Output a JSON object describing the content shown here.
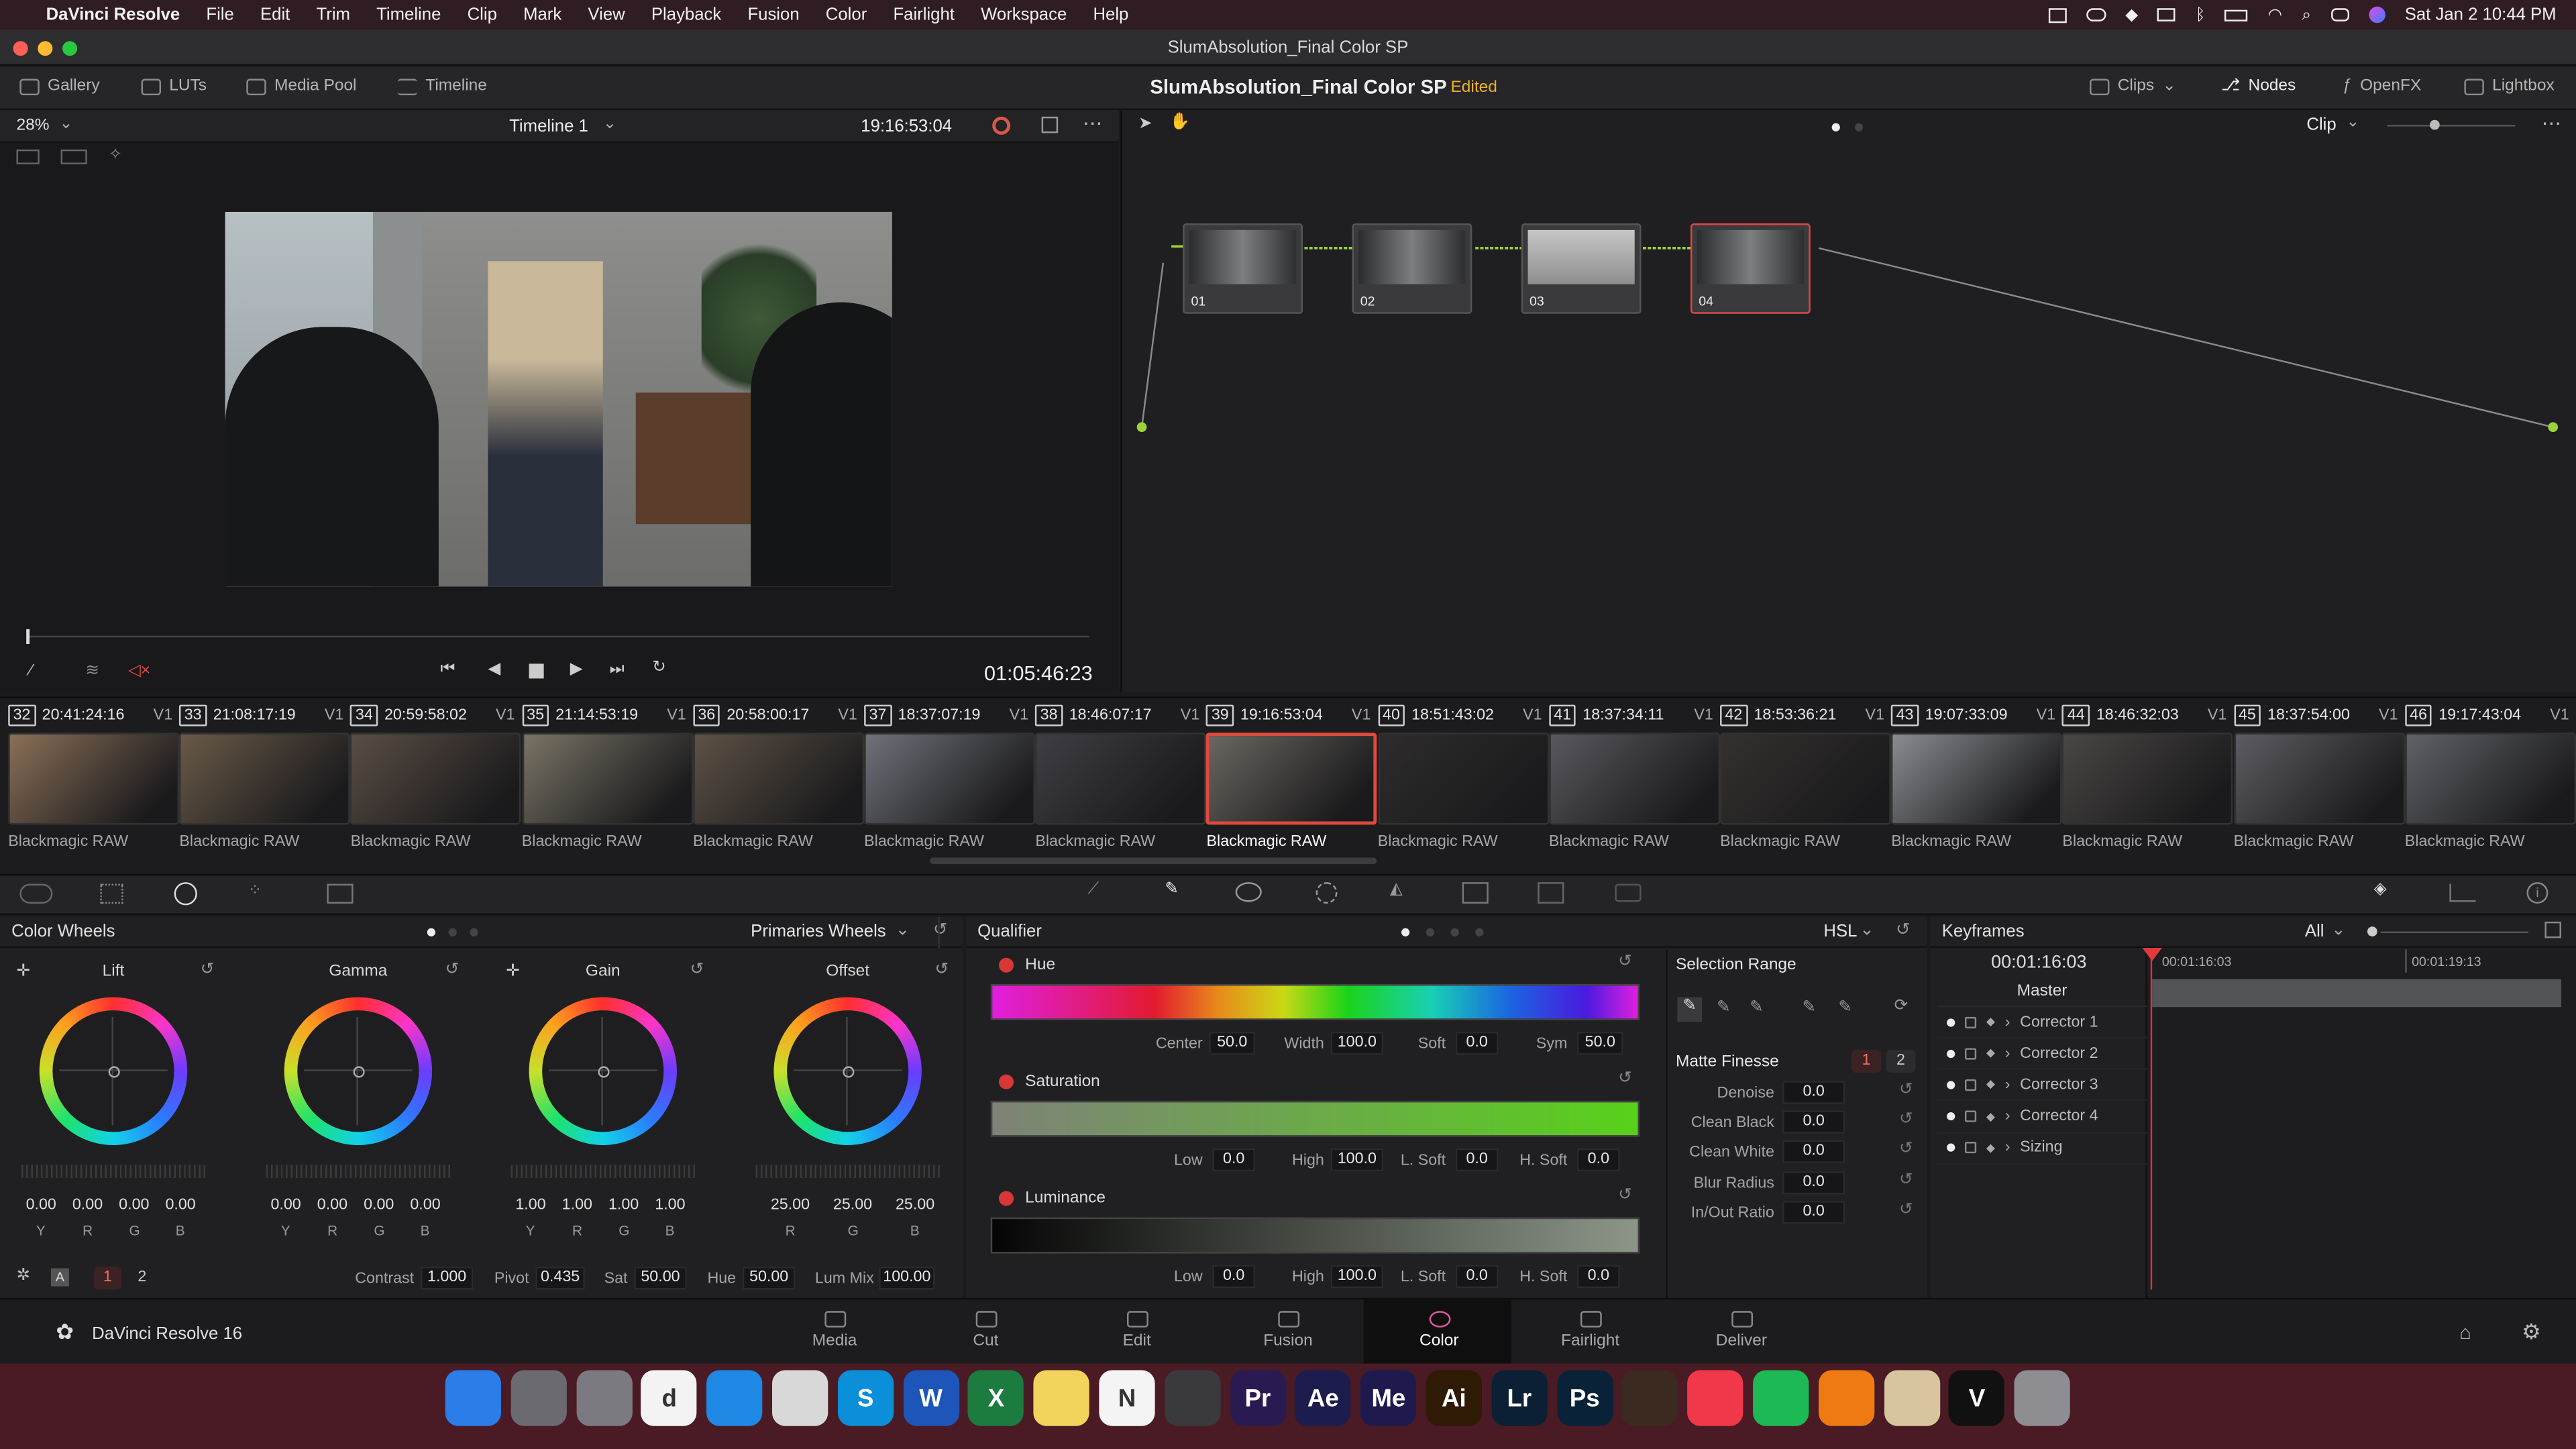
{
  "menubar": {
    "apple": "",
    "app": "DaVinci Resolve",
    "items": [
      "File",
      "Edit",
      "Trim",
      "Timeline",
      "Clip",
      "Mark",
      "View",
      "Playback",
      "Fusion",
      "Color",
      "Fairlight",
      "Workspace",
      "Help"
    ],
    "clock": "Sat Jan 2  10:44 PM"
  },
  "window": {
    "title": "SlumAbsolution_Final Color SP"
  },
  "toolbar": {
    "gallery": "Gallery",
    "luts": "LUTs",
    "media_pool": "Media Pool",
    "timeline": "Timeline",
    "project": "SlumAbsolution_Final Color SP",
    "status": "Edited",
    "clips": "Clips",
    "nodes": "Nodes",
    "openfx": "OpenFX",
    "lightbox": "Lightbox"
  },
  "viewer": {
    "zoom": "28%",
    "timeline_name": "Timeline 1",
    "source_tc": "19:16:53:04",
    "playhead_tc": "01:05:46:23"
  },
  "node_editor": {
    "mode": "Clip",
    "nodes": [
      {
        "label": "01"
      },
      {
        "label": "02"
      },
      {
        "label": "03"
      },
      {
        "label": "04"
      }
    ]
  },
  "clips": [
    {
      "num": "32",
      "tc": "20:41:24:16",
      "track": "V1",
      "name": "Blackmagic RAW",
      "tone": "#8a7058"
    },
    {
      "num": "33",
      "tc": "21:08:17:19",
      "track": "V1",
      "name": "Blackmagic RAW",
      "tone": "#6a5a48"
    },
    {
      "num": "34",
      "tc": "20:59:58:02",
      "track": "V1",
      "name": "Blackmagic RAW",
      "tone": "#5a4e44"
    },
    {
      "num": "35",
      "tc": "21:14:53:19",
      "track": "V1",
      "name": "Blackmagic RAW",
      "tone": "#7a7466"
    },
    {
      "num": "36",
      "tc": "20:58:00:17",
      "track": "V1",
      "name": "Blackmagic RAW",
      "tone": "#5e5246"
    },
    {
      "num": "37",
      "tc": "18:37:07:19",
      "track": "V1",
      "name": "Blackmagic RAW",
      "tone": "#70727a"
    },
    {
      "num": "38",
      "tc": "18:46:07:17",
      "track": "V1",
      "name": "Blackmagic RAW",
      "tone": "#3e3e44"
    },
    {
      "num": "39",
      "tc": "19:16:53:04",
      "track": "V1",
      "name": "Blackmagic RAW",
      "tone": "#6a6660"
    },
    {
      "num": "40",
      "tc": "18:51:43:02",
      "track": "V1",
      "name": "Blackmagic RAW",
      "tone": "#2e2c2c"
    },
    {
      "num": "41",
      "tc": "18:37:34:11",
      "track": "V1",
      "name": "Blackmagic RAW",
      "tone": "#58585e"
    },
    {
      "num": "42",
      "tc": "18:53:36:21",
      "track": "V1",
      "name": "Blackmagic RAW",
      "tone": "#34302e"
    },
    {
      "num": "43",
      "tc": "19:07:33:09",
      "track": "V1",
      "name": "Blackmagic RAW",
      "tone": "#8a8c92"
    },
    {
      "num": "44",
      "tc": "18:46:32:03",
      "track": "V1",
      "name": "Blackmagic RAW",
      "tone": "#4a4644"
    },
    {
      "num": "45",
      "tc": "18:37:54:00",
      "track": "V1",
      "name": "Blackmagic RAW",
      "tone": "#5c5c62"
    },
    {
      "num": "46",
      "tc": "19:17:43:04",
      "track": "V1",
      "name": "Blackmagic RAW",
      "tone": "#606268"
    }
  ],
  "color_wheels": {
    "title": "Color Wheels",
    "mode": "Primaries Wheels",
    "wheels": [
      {
        "name": "Lift",
        "values": [
          "0.00",
          "0.00",
          "0.00",
          "0.00"
        ],
        "channels": [
          "Y",
          "R",
          "G",
          "B"
        ]
      },
      {
        "name": "Gamma",
        "values": [
          "0.00",
          "0.00",
          "0.00",
          "0.00"
        ],
        "channels": [
          "Y",
          "R",
          "G",
          "B"
        ]
      },
      {
        "name": "Gain",
        "values": [
          "1.00",
          "1.00",
          "1.00",
          "1.00"
        ],
        "channels": [
          "Y",
          "R",
          "G",
          "B"
        ]
      },
      {
        "name": "Offset",
        "values": [
          "25.00",
          "25.00",
          "25.00"
        ],
        "channels": [
          "R",
          "G",
          "B"
        ]
      }
    ],
    "page1": "1",
    "page2": "2",
    "contrast_label": "Contrast",
    "contrast": "1.000",
    "pivot_label": "Pivot",
    "pivot": "0.435",
    "sat_label": "Sat",
    "sat": "50.00",
    "hue_label": "Hue",
    "hue": "50.00",
    "lummix_label": "Lum Mix",
    "lummix": "100.00"
  },
  "qualifier": {
    "title": "Qualifier",
    "mode": "HSL",
    "hue": {
      "label": "Hue",
      "center_label": "Center",
      "center": "50.0",
      "width_label": "Width",
      "width": "100.0",
      "soft_label": "Soft",
      "soft": "0.0",
      "sym_label": "Sym",
      "sym": "50.0"
    },
    "saturation": {
      "label": "Saturation",
      "low_label": "Low",
      "low": "0.0",
      "high_label": "High",
      "high": "100.0",
      "lsoft_label": "L. Soft",
      "lsoft": "0.0",
      "hsoft_label": "H. Soft",
      "hsoft": "0.0"
    },
    "luminance": {
      "label": "Luminance",
      "low_label": "Low",
      "low": "0.0",
      "high_label": "High",
      "high": "100.0",
      "lsoft_label": "L. Soft",
      "lsoft": "0.0",
      "hsoft_label": "H. Soft",
      "hsoft": "0.0"
    },
    "selection_range": "Selection Range",
    "matte_finesse": "Matte Finesse",
    "mf_page1": "1",
    "mf_page2": "2",
    "finesse": [
      {
        "label": "Denoise",
        "value": "0.0"
      },
      {
        "label": "Clean Black",
        "value": "0.0"
      },
      {
        "label": "Clean White",
        "value": "0.0"
      },
      {
        "label": "Blur Radius",
        "value": "0.0"
      },
      {
        "label": "In/Out Ratio",
        "value": "0.0"
      }
    ]
  },
  "keyframes": {
    "title": "Keyframes",
    "filter": "All",
    "current_tc": "00:01:16:03",
    "ruler_start": "00:01:16:03",
    "ruler_end": "00:01:19:13",
    "master": "Master",
    "rows": [
      "Corrector 1",
      "Corrector 2",
      "Corrector 3",
      "Corrector 4",
      "Sizing"
    ]
  },
  "pages": {
    "app_label": "DaVinci Resolve 16",
    "items": [
      "Media",
      "Cut",
      "Edit",
      "Fusion",
      "Color",
      "Fairlight",
      "Deliver"
    ],
    "active": "Color"
  },
  "dock": [
    {
      "name": "finder-icon",
      "glyph": "",
      "color": "#2b7de9"
    },
    {
      "name": "launchpad-icon",
      "glyph": "",
      "color": "#6a6a70"
    },
    {
      "name": "system-preferences-icon",
      "glyph": "",
      "color": "#7a7a80"
    },
    {
      "name": "dictionary-icon",
      "glyph": "d",
      "color": "#f3f3f3"
    },
    {
      "name": "safari-icon",
      "glyph": "",
      "color": "#1e88e5"
    },
    {
      "name": "chrome-icon",
      "glyph": "",
      "color": "#d8d8d8"
    },
    {
      "name": "skype-icon",
      "glyph": "S",
      "color": "#0a8fd8"
    },
    {
      "name": "word-icon",
      "glyph": "W",
      "color": "#1d56b8"
    },
    {
      "name": "excel-icon",
      "glyph": "X",
      "color": "#1c7b3f"
    },
    {
      "name": "notes-icon",
      "glyph": "",
      "color": "#f2d45c"
    },
    {
      "name": "notion-icon",
      "glyph": "N",
      "color": "#f4f4f4"
    },
    {
      "name": "davinci-resolve-icon",
      "glyph": "",
      "color": "#3a3a3e"
    },
    {
      "name": "premiere-icon",
      "glyph": "Pr",
      "color": "#2a1a52"
    },
    {
      "name": "after-effects-icon",
      "glyph": "Ae",
      "color": "#1d1c4f"
    },
    {
      "name": "media-encoder-icon",
      "glyph": "Me",
      "color": "#1f1a4e"
    },
    {
      "name": "illustrator-icon",
      "glyph": "Ai",
      "color": "#2f1a05"
    },
    {
      "name": "lightroom-icon",
      "glyph": "Lr",
      "color": "#0b2035"
    },
    {
      "name": "photoshop-icon",
      "glyph": "Ps",
      "color": "#0a2238"
    },
    {
      "name": "garageband-icon",
      "glyph": "",
      "color": "#3b2a20"
    },
    {
      "name": "music-icon",
      "glyph": "",
      "color": "#f1384a"
    },
    {
      "name": "spotify-icon",
      "glyph": "",
      "color": "#1db954"
    },
    {
      "name": "vlc-icon",
      "glyph": "",
      "color": "#f07a12"
    },
    {
      "name": "preview-icon",
      "glyph": "",
      "color": "#d9c4a0"
    },
    {
      "name": "vectorworks-icon",
      "glyph": "V",
      "color": "#111111"
    },
    {
      "name": "trash-icon",
      "glyph": "",
      "color": "#8d8d92"
    }
  ]
}
